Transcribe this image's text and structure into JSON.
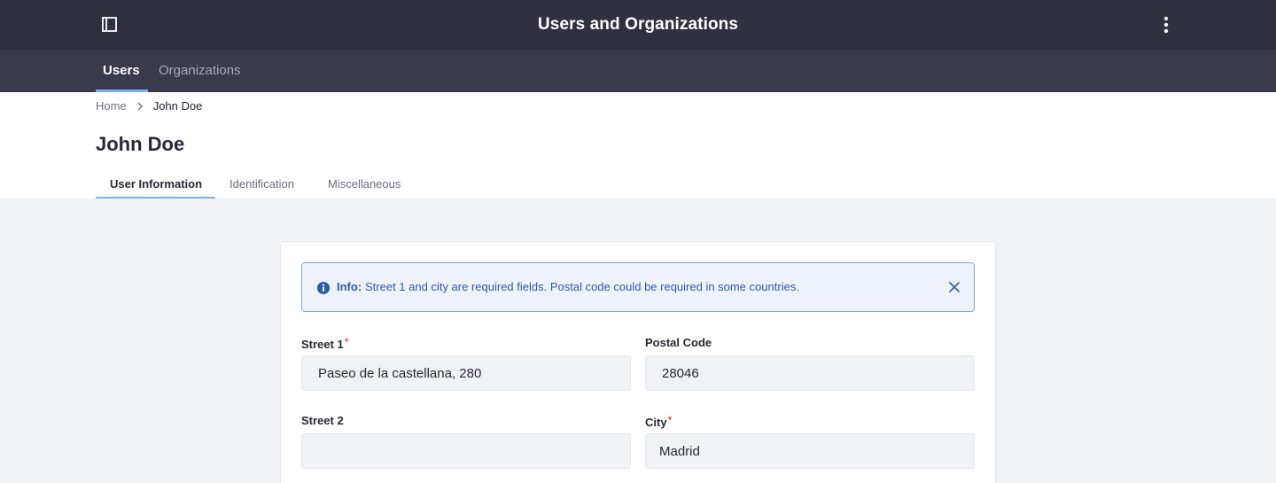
{
  "app": {
    "title": "Users and Organizations"
  },
  "nav": {
    "tabs": [
      {
        "label": "Users",
        "active": true
      },
      {
        "label": "Organizations",
        "active": false
      }
    ]
  },
  "breadcrumb": {
    "home": "Home",
    "current": "John Doe"
  },
  "page": {
    "title": "John Doe",
    "tabs": [
      {
        "label": "User Information",
        "active": true
      },
      {
        "label": "Identification",
        "active": false
      },
      {
        "label": "Miscellaneous",
        "active": false
      }
    ]
  },
  "alert": {
    "lead": "Info:",
    "text": "Street 1 and city are required fields. Postal code could be required in some countries."
  },
  "form": {
    "street1": {
      "label": "Street 1",
      "required_mark": "*",
      "value": "Paseo de la castellana, 280"
    },
    "postal_code": {
      "label": "Postal Code",
      "value": "28046"
    },
    "street2": {
      "label": "Street 2",
      "value": ""
    },
    "city": {
      "label": "City",
      "required_mark": "*",
      "value": "Madrid"
    }
  },
  "icons": {
    "panel_toggle": "sidebar-panel-icon",
    "menu": "vertical-ellipsis-icon",
    "breadcrumb_separator": "chevron-right-icon",
    "alert": "info-circle-icon",
    "alert_close": "close-icon"
  },
  "colors": {
    "topbar": "#30313f",
    "navbar": "#393a4a",
    "accent": "#80acff",
    "info": "#2e5aac",
    "required": "#da1414"
  }
}
